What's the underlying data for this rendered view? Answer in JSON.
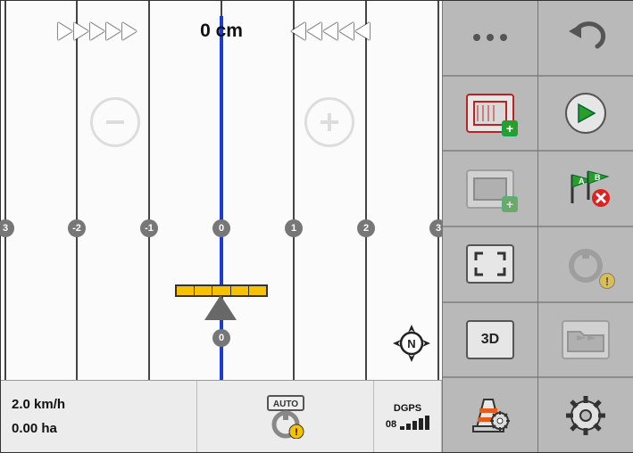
{
  "guidance": {
    "offset_readout": "0 cm",
    "swath_labels": [
      "3",
      "-2",
      "-1",
      "0",
      "1",
      "2",
      "3"
    ]
  },
  "status": {
    "speed": "2.0 km/h",
    "area": "0.00 ha",
    "auto_label": "AUTO",
    "gps_mode": "DGPS",
    "gps_sat": "08"
  },
  "compass": {
    "letter": "N"
  },
  "tool_labels": {
    "threeD": "3D"
  }
}
